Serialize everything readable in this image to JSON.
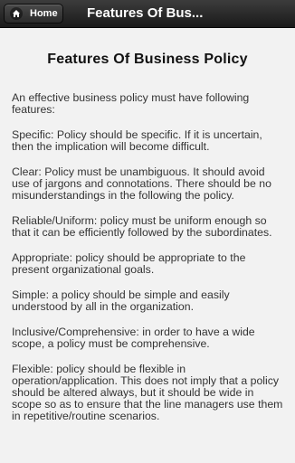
{
  "header": {
    "home_label": "Home",
    "title": "Features Of Bus..."
  },
  "main": {
    "heading": "Features Of Business Policy",
    "paragraphs": [
      "An effective business policy must have following features:",
      "Specific: Policy should be specific. If it is uncertain, then the implication will become difficult.",
      "Clear: Policy must be unambiguous. It should avoid use of jargons and connotations. There should be no misunderstandings in the following the policy.",
      "Reliable/Uniform: policy must be uniform enough so that it can be efficiently followed by the subordinates.",
      "Appropriate: policy should be appropriate to the present organizational goals.",
      "Simple: a policy should be simple and easily understood by all in the organization.",
      "Inclusive/Comprehensive: in order to have a wide scope, a policy must be comprehensive.",
      "Flexible: policy should be flexible in operation/application. This does not imply that a policy should be altered always, but it should be wide in scope so as to ensure that the line managers use them in repetitive/routine scenarios."
    ]
  },
  "colors": {
    "header_bg": "#222222",
    "page_bg": "#f2f2f2",
    "text": "#333333"
  },
  "icons": {
    "home": "home-icon"
  }
}
